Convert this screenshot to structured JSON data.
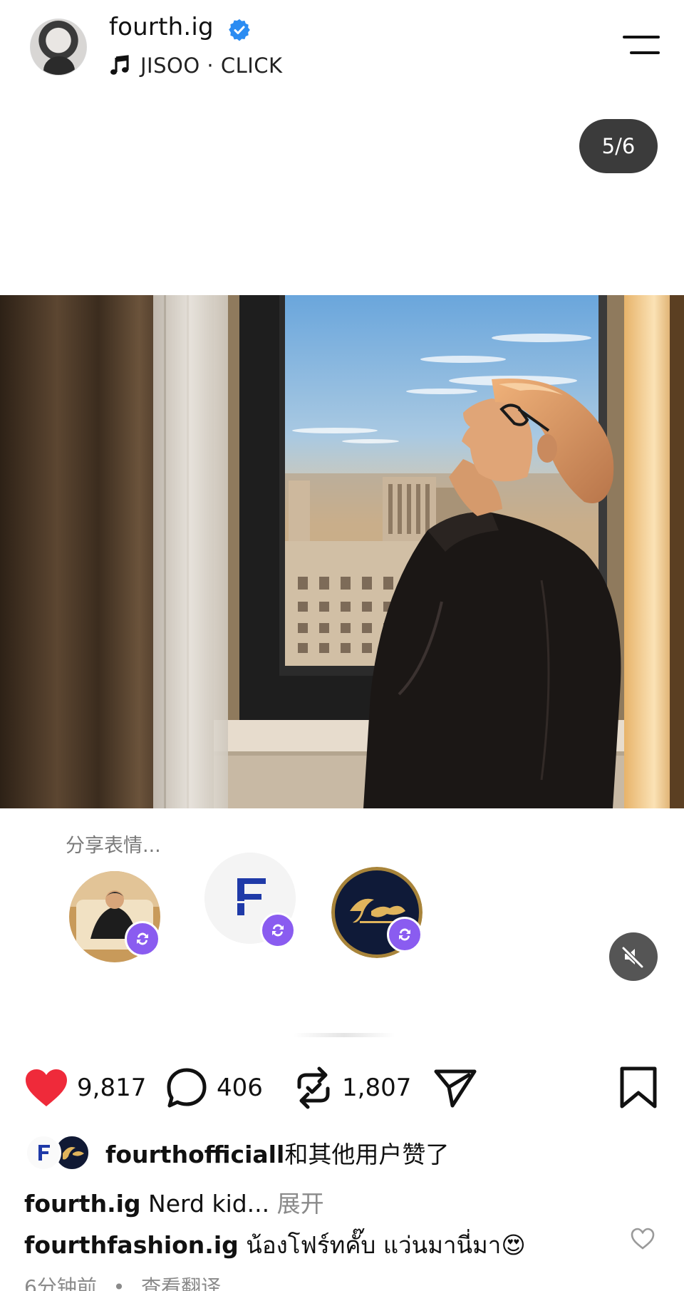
{
  "header": {
    "username": "fourth.ig",
    "music": "JISOO · CLICK",
    "page_indicator": "5/6"
  },
  "share_panel": {
    "label": "分享表情..."
  },
  "stats": {
    "likes": "9,817",
    "comments": "406",
    "reposts": "1,807"
  },
  "liked_by": {
    "user": "fourthofficiall",
    "suffix": "和其他用户赞了"
  },
  "captions": [
    {
      "user": "fourth.ig",
      "text": "Nerd kid...",
      "more": "展开"
    },
    {
      "user": "fourthfashion.ig",
      "text": "น้องโฟร์ทคั๊บ แว่นมานี่มา😍"
    }
  ],
  "meta": {
    "time": "6分钟前",
    "separator": "•",
    "translate": "查看翻译"
  },
  "colors": {
    "like": "#ef2a3a",
    "repost_badge": "#8a5cf0",
    "verified": "#2b8cf2"
  }
}
